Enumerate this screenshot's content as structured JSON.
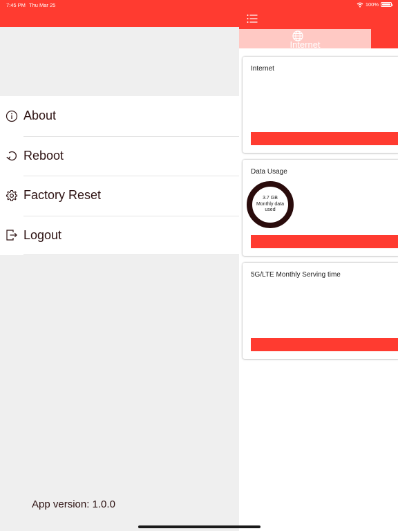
{
  "status_bar": {
    "time": "7:45 PM",
    "date": "Thu Mar 25",
    "battery": "100%",
    "battery_level": 1.0
  },
  "drawer": {
    "menu": [
      {
        "label": "About",
        "icon": "info-icon"
      },
      {
        "label": "Reboot",
        "icon": "reboot-icon"
      },
      {
        "label": "Factory Reset",
        "icon": "gear-icon"
      },
      {
        "label": "Logout",
        "icon": "logout-icon"
      }
    ],
    "app_version": "App version: 1.0.0"
  },
  "main": {
    "tab": {
      "label": "Internet",
      "icon": "globe-icon"
    },
    "cards": [
      {
        "title": "Internet"
      },
      {
        "title": "Data Usage",
        "donut_value": "3.7 GB",
        "donut_line1": "Monthly data",
        "donut_line2": "used"
      },
      {
        "title": "5G/LTE Monthly Serving time"
      }
    ]
  },
  "colors": {
    "accent": "#ff3b30",
    "tab_background": "#ffc9c4",
    "drawer_background": "#efefef",
    "donut_ring": "#2a0c0c"
  }
}
